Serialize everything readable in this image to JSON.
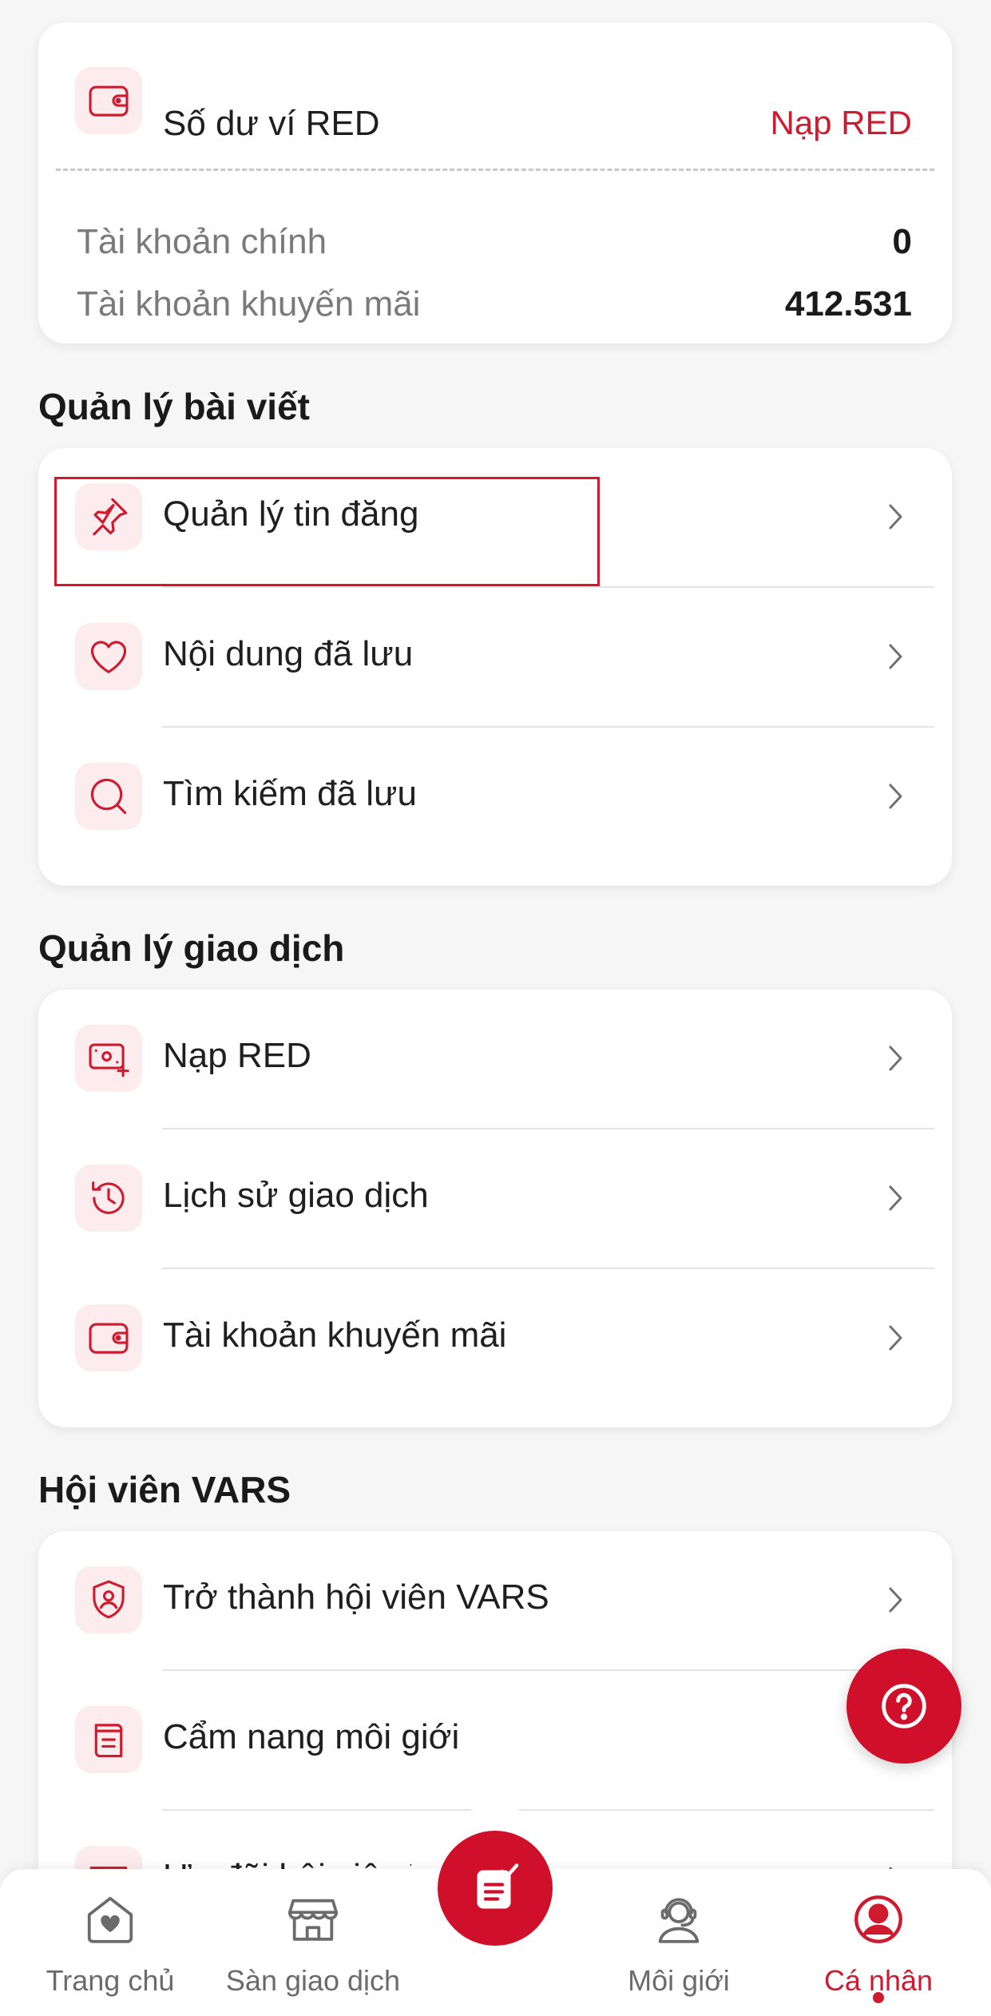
{
  "wallet": {
    "title": "Số dư ví RED",
    "topup_link": "Nạp RED",
    "main_account_label": "Tài khoản chính",
    "main_account_value": "0",
    "promo_account_label": "Tài khoản khuyến mãi",
    "promo_account_value": "412.531"
  },
  "posts_section": {
    "title": "Quản lý bài viết",
    "items": [
      {
        "label": "Quản lý tin đăng",
        "icon": "pin-icon"
      },
      {
        "label": "Nội dung đã lưu",
        "icon": "heart-icon"
      },
      {
        "label": "Tìm kiếm đã lưu",
        "icon": "search-icon"
      }
    ]
  },
  "transactions_section": {
    "title": "Quản lý giao dịch",
    "items": [
      {
        "label": "Nạp RED",
        "icon": "money-add-icon"
      },
      {
        "label": "Lịch sử giao dịch",
        "icon": "history-icon"
      },
      {
        "label": "Tài khoản khuyến mãi",
        "icon": "wallet-icon"
      }
    ]
  },
  "vars_section": {
    "title": "Hội viên VARS",
    "items": [
      {
        "label": "Trở thành hội viên VARS",
        "icon": "shield-user-icon"
      },
      {
        "label": "Cẩm nang môi giới",
        "icon": "handbook-icon"
      },
      {
        "label": "Ưu đãi hội viên VARS",
        "icon": "gift-icon"
      }
    ]
  },
  "tabbar": {
    "tabs": [
      {
        "label": "Trang chủ",
        "icon": "home-heart-icon"
      },
      {
        "label": "Sàn giao dịch",
        "icon": "store-icon"
      },
      {
        "label": "Môi giới",
        "icon": "agent-icon"
      },
      {
        "label": "Cá nhân",
        "icon": "user-circle-icon",
        "active": true
      }
    ],
    "center_icon": "post-note-icon"
  },
  "colors": {
    "accent": "#cf1b2f",
    "icon_bg": "#fcecee",
    "highlight_border": "#d4172b"
  }
}
